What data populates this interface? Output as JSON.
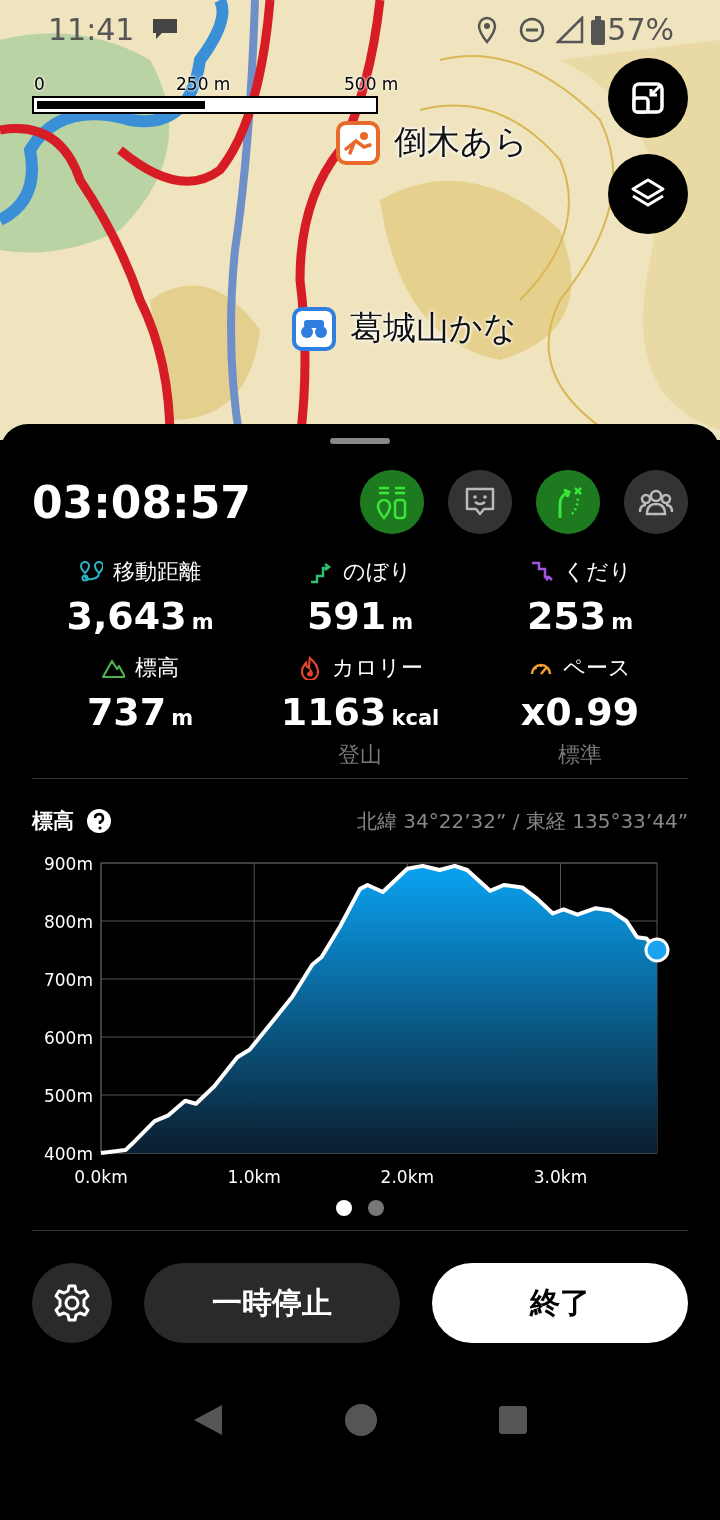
{
  "status_bar": {
    "time": "11:41",
    "battery": "57%"
  },
  "map": {
    "scale_bar": [
      "0",
      "250 m",
      "500 m"
    ],
    "markers": [
      {
        "kind": "hazard",
        "label": "倒木あら"
      },
      {
        "kind": "viewpoint",
        "label": "葛城山かな"
      }
    ],
    "buttons": [
      {
        "kind": "shrink"
      },
      {
        "kind": "layers"
      }
    ]
  },
  "tracking": {
    "elapsed": "03:08:57",
    "actions": [
      {
        "kind": "checkpoints",
        "on": true
      },
      {
        "kind": "report",
        "on": false
      },
      {
        "kind": "route",
        "on": true
      },
      {
        "kind": "group",
        "on": false
      }
    ]
  },
  "stats": [
    {
      "kind": "distance",
      "label": "移動距離",
      "value": "3,643",
      "unit": "m"
    },
    {
      "kind": "ascent",
      "label": "のぼり",
      "value": "591",
      "unit": "m"
    },
    {
      "kind": "descent",
      "label": "くだり",
      "value": "253",
      "unit": "m"
    },
    {
      "kind": "elevation",
      "label": "標高",
      "value": "737",
      "unit": "m"
    },
    {
      "kind": "calories",
      "label": "カロリー",
      "value": "1163",
      "unit": "kcal",
      "note": "登山"
    },
    {
      "kind": "pace",
      "label": "ペース",
      "value": "x0.99",
      "note": "標準"
    }
  ],
  "elevation": {
    "title": "標高",
    "coordinates": "北緯 34°22’32” / 東経 135°33’44”",
    "chart_data": {
      "type": "area",
      "grid": true,
      "xlim": [
        0,
        3.63
      ],
      "ylim": [
        400,
        900
      ],
      "xticks": [
        {
          "value": 0,
          "label": "0.0km"
        },
        {
          "value": 1,
          "label": "1.0km"
        },
        {
          "value": 2,
          "label": "2.0km"
        },
        {
          "value": 3,
          "label": "3.0km"
        }
      ],
      "yticks": [
        {
          "value": 400,
          "label": "400m"
        },
        {
          "value": 500,
          "label": "500m"
        },
        {
          "value": 600,
          "label": "600m"
        },
        {
          "value": 700,
          "label": "700m"
        },
        {
          "value": 800,
          "label": "800m"
        },
        {
          "value": 900,
          "label": "900m"
        }
      ],
      "x": [
        0,
        0.16,
        0.2,
        0.35,
        0.44,
        0.55,
        0.62,
        0.74,
        0.89,
        0.97,
        1.13,
        1.25,
        1.38,
        1.44,
        1.56,
        1.69,
        1.74,
        1.84,
        2.0,
        2.1,
        2.21,
        2.31,
        2.39,
        2.54,
        2.63,
        2.75,
        2.84,
        2.95,
        3.02,
        3.11,
        3.23,
        3.33,
        3.43,
        3.5,
        3.56,
        3.63
      ],
      "values": [
        400,
        405,
        415,
        455,
        465,
        490,
        485,
        515,
        565,
        578,
        630,
        670,
        725,
        738,
        790,
        855,
        862,
        850,
        890,
        895,
        888,
        895,
        888,
        852,
        862,
        858,
        840,
        813,
        820,
        811,
        822,
        818,
        800,
        772,
        770,
        750
      ]
    }
  },
  "pager": [
    {
      "selected": true
    },
    {
      "selected": false
    }
  ],
  "buttons": [
    {
      "kind": "settings"
    },
    {
      "kind": "pause",
      "label": "一時停止"
    },
    {
      "kind": "finish",
      "label": "終了"
    }
  ]
}
